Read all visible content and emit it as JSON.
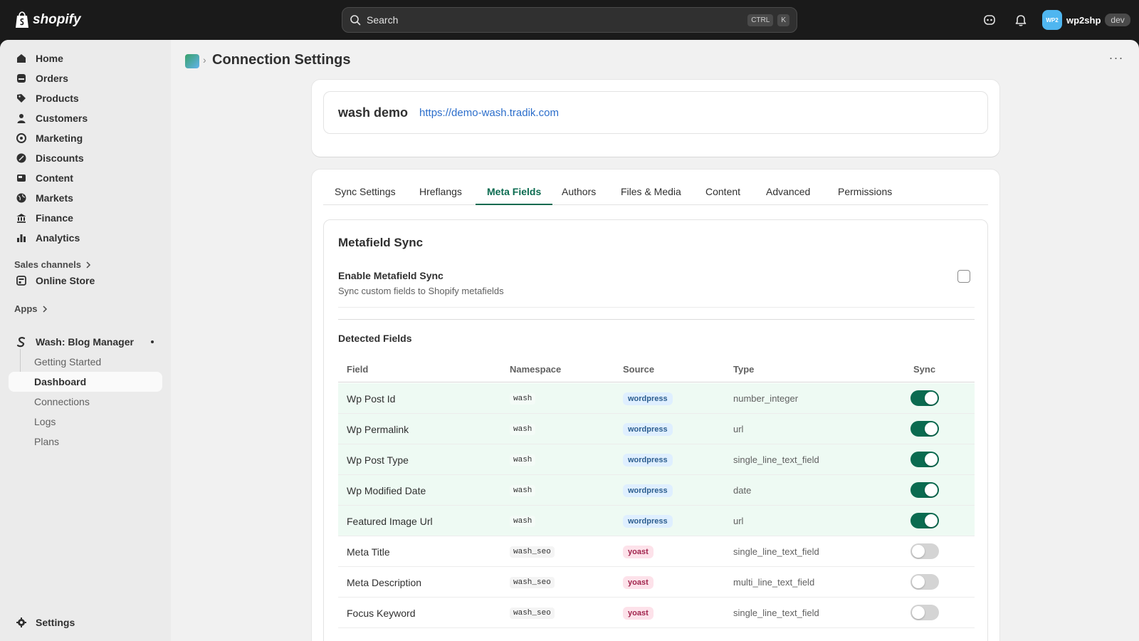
{
  "topbar": {
    "logo_text": "shopify",
    "search_placeholder": "Search",
    "shortcut_ctrl": "CTRL",
    "shortcut_k": "K",
    "account_initials": "WP2",
    "account_name": "wp2shp",
    "account_badge": "dev"
  },
  "sidebar": {
    "nav": [
      {
        "label": "Home",
        "icon": "home-icon"
      },
      {
        "label": "Orders",
        "icon": "orders-icon"
      },
      {
        "label": "Products",
        "icon": "tag-icon"
      },
      {
        "label": "Customers",
        "icon": "person-icon"
      },
      {
        "label": "Marketing",
        "icon": "target-icon"
      },
      {
        "label": "Discounts",
        "icon": "discount-icon"
      },
      {
        "label": "Content",
        "icon": "content-icon"
      },
      {
        "label": "Markets",
        "icon": "globe-icon"
      },
      {
        "label": "Finance",
        "icon": "bank-icon"
      },
      {
        "label": "Analytics",
        "icon": "bar-chart-icon"
      }
    ],
    "sales_channels_label": "Sales channels",
    "online_store_label": "Online Store",
    "apps_label": "Apps",
    "app_name": "Wash: Blog Manager",
    "app_subitems": [
      "Getting Started",
      "Dashboard",
      "Connections",
      "Logs",
      "Plans"
    ],
    "active_subitem": "Dashboard",
    "settings_label": "Settings"
  },
  "page": {
    "title": "Connection Settings",
    "breadcrumb_sep": "›",
    "more_actions": "···"
  },
  "connection": {
    "name": "wash demo",
    "url": "https://demo-wash.tradik.com"
  },
  "tabs": [
    "Sync Settings",
    "Hreflangs",
    "Meta Fields",
    "Authors",
    "Files & Media",
    "Content",
    "Advanced",
    "Permissions"
  ],
  "active_tab": "Meta Fields",
  "metafield_sync": {
    "heading": "Metafield Sync",
    "enable_label": "Enable Metafield Sync",
    "enable_description": "Sync custom fields to Shopify metafields",
    "enabled": false
  },
  "detected_fields": {
    "heading": "Detected Fields",
    "columns": [
      "Field",
      "Namespace",
      "Source",
      "Type",
      "Sync"
    ],
    "rows": [
      {
        "field": "Wp Post Id",
        "namespace": "wash",
        "source": "wordpress",
        "type": "number_integer",
        "sync": true
      },
      {
        "field": "Wp Permalink",
        "namespace": "wash",
        "source": "wordpress",
        "type": "url",
        "sync": true
      },
      {
        "field": "Wp Post Type",
        "namespace": "wash",
        "source": "wordpress",
        "type": "single_line_text_field",
        "sync": true
      },
      {
        "field": "Wp Modified Date",
        "namespace": "wash",
        "source": "wordpress",
        "type": "date",
        "sync": true
      },
      {
        "field": "Featured Image Url",
        "namespace": "wash",
        "source": "wordpress",
        "type": "url",
        "sync": true
      },
      {
        "field": "Meta Title",
        "namespace": "wash_seo",
        "source": "yoast",
        "type": "single_line_text_field",
        "sync": false
      },
      {
        "field": "Meta Description",
        "namespace": "wash_seo",
        "source": "yoast",
        "type": "multi_line_text_field",
        "sync": false
      },
      {
        "field": "Focus Keyword",
        "namespace": "wash_seo",
        "source": "yoast",
        "type": "single_line_text_field",
        "sync": false
      }
    ]
  },
  "colors": {
    "accent": "#0b6b50",
    "link": "#2c6ecb",
    "synced_row_bg": "#eefaf3"
  }
}
